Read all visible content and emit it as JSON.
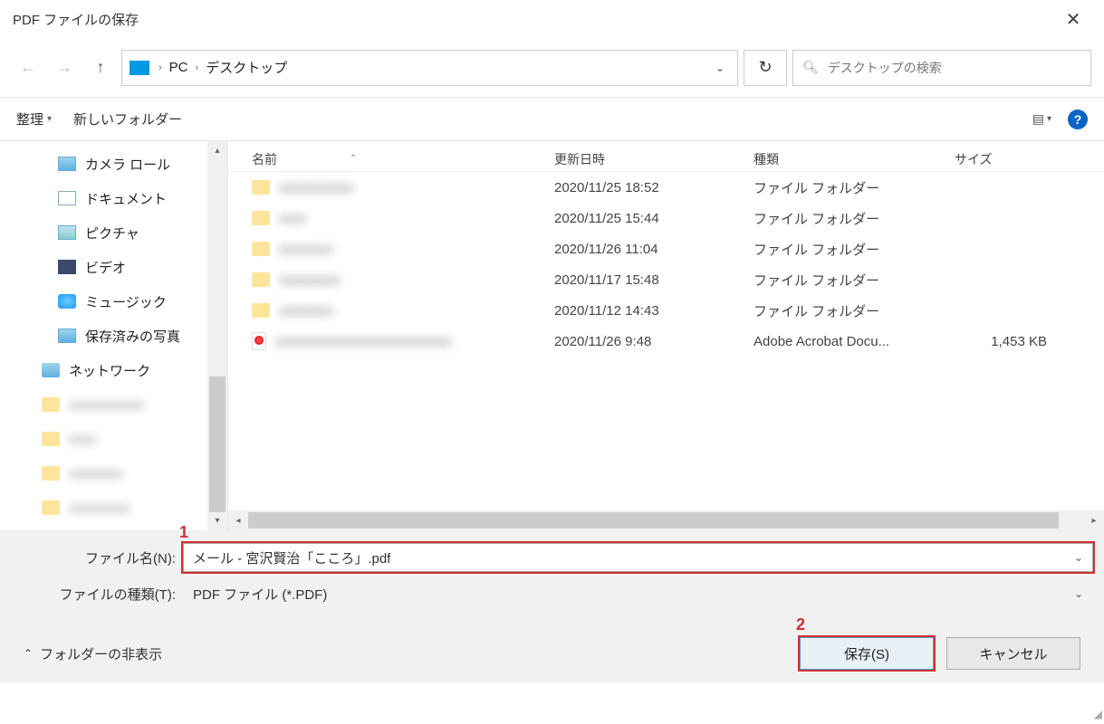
{
  "titlebar": {
    "title": "PDF ファイルの保存"
  },
  "breadcrumb": {
    "pc": "PC",
    "desktop": "デスクトップ"
  },
  "search": {
    "placeholder": "デスクトップの検索"
  },
  "toolbar": {
    "organize": "整理",
    "newfolder": "新しいフォルダー"
  },
  "sidebar": {
    "items": [
      {
        "label": "カメラ ロール"
      },
      {
        "label": "ドキュメント"
      },
      {
        "label": "ピクチャ"
      },
      {
        "label": "ビデオ"
      },
      {
        "label": "ミュージック"
      },
      {
        "label": "保存済みの写真"
      }
    ],
    "network": "ネットワーク"
  },
  "columns": {
    "name": "名前",
    "date": "更新日時",
    "type": "種類",
    "size": "サイズ"
  },
  "files": [
    {
      "name": "xxxxxxxxxxx",
      "date": "2020/11/25 18:52",
      "type": "ファイル フォルダー",
      "size": "",
      "kind": "folder"
    },
    {
      "name": "xxxx",
      "date": "2020/11/25 15:44",
      "type": "ファイル フォルダー",
      "size": "",
      "kind": "folder"
    },
    {
      "name": "xxxxxxxx",
      "date": "2020/11/26 11:04",
      "type": "ファイル フォルダー",
      "size": "",
      "kind": "folder"
    },
    {
      "name": "xxxxxxxxx",
      "date": "2020/11/17 15:48",
      "type": "ファイル フォルダー",
      "size": "",
      "kind": "folder"
    },
    {
      "name": "xxxxxxxx",
      "date": "2020/11/12 14:43",
      "type": "ファイル フォルダー",
      "size": "",
      "kind": "folder"
    },
    {
      "name": "xxxxxxxxxxxxxxxxxxxxxxxxxx",
      "date": "2020/11/26 9:48",
      "type": "Adobe Acrobat Docu...",
      "size": "1,453 KB",
      "kind": "pdf"
    }
  ],
  "filename": {
    "label": "ファイル名(N):",
    "value": "メール - 宮沢賢治「こころ」.pdf"
  },
  "filetype": {
    "label": "ファイルの種類(T):",
    "value": "PDF ファイル (*.PDF)"
  },
  "footer": {
    "hide": "フォルダーの非表示",
    "save": "保存(S)",
    "cancel": "キャンセル"
  },
  "annotations": {
    "one": "1",
    "two": "2"
  }
}
